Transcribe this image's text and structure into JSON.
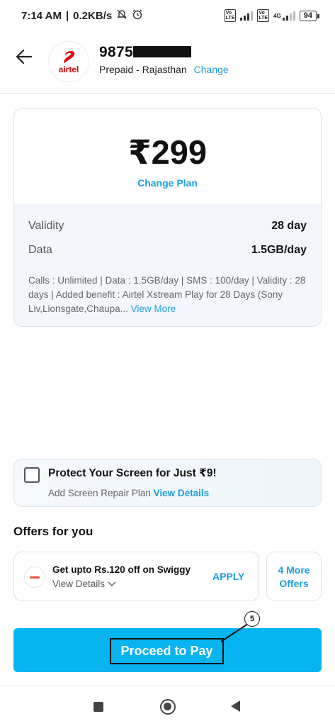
{
  "status_bar": {
    "time": "7:14 AM",
    "speed": "0.2KB/s",
    "network_4g": "4G",
    "volte": "Vo LTE",
    "battery": "94"
  },
  "header": {
    "back_icon": "arrow-left-icon",
    "logo_text": "airtel",
    "phone_number_visible": "9875",
    "circle_info": "Prepaid - Rajasthan",
    "change_label": "Change"
  },
  "plan": {
    "price": "₹299",
    "change_plan_label": "Change Plan",
    "details": [
      {
        "label": "Validity",
        "value": "28 day"
      },
      {
        "label": "Data",
        "value": "1.5GB/day"
      }
    ],
    "description": "Calls : Unlimited | Data : 1.5GB/day | SMS : 100/day | Validity : 28 days | Added benefit : Airtel Xstream Play for 28 Days (Sony Liv,Lionsgate,Chaupa...",
    "view_more_label": "View More"
  },
  "protect": {
    "title": "Protect Your Screen for Just ₹9!",
    "subtitle": "Add Screen Repair Plan",
    "link": "View Details"
  },
  "offers": {
    "heading": "Offers for you",
    "offer_title": "Get upto Rs.120 off on Swiggy",
    "offer_details": "View Details",
    "apply_label": "APPLY",
    "more_offers_line1": "4 More",
    "more_offers_line2": "Offers"
  },
  "pay": {
    "label": "Proceed to Pay",
    "annotation": "5"
  },
  "colors": {
    "accent": "#1b9fe0",
    "pay_button": "#08b4ef",
    "brand_red": "#e40000"
  }
}
